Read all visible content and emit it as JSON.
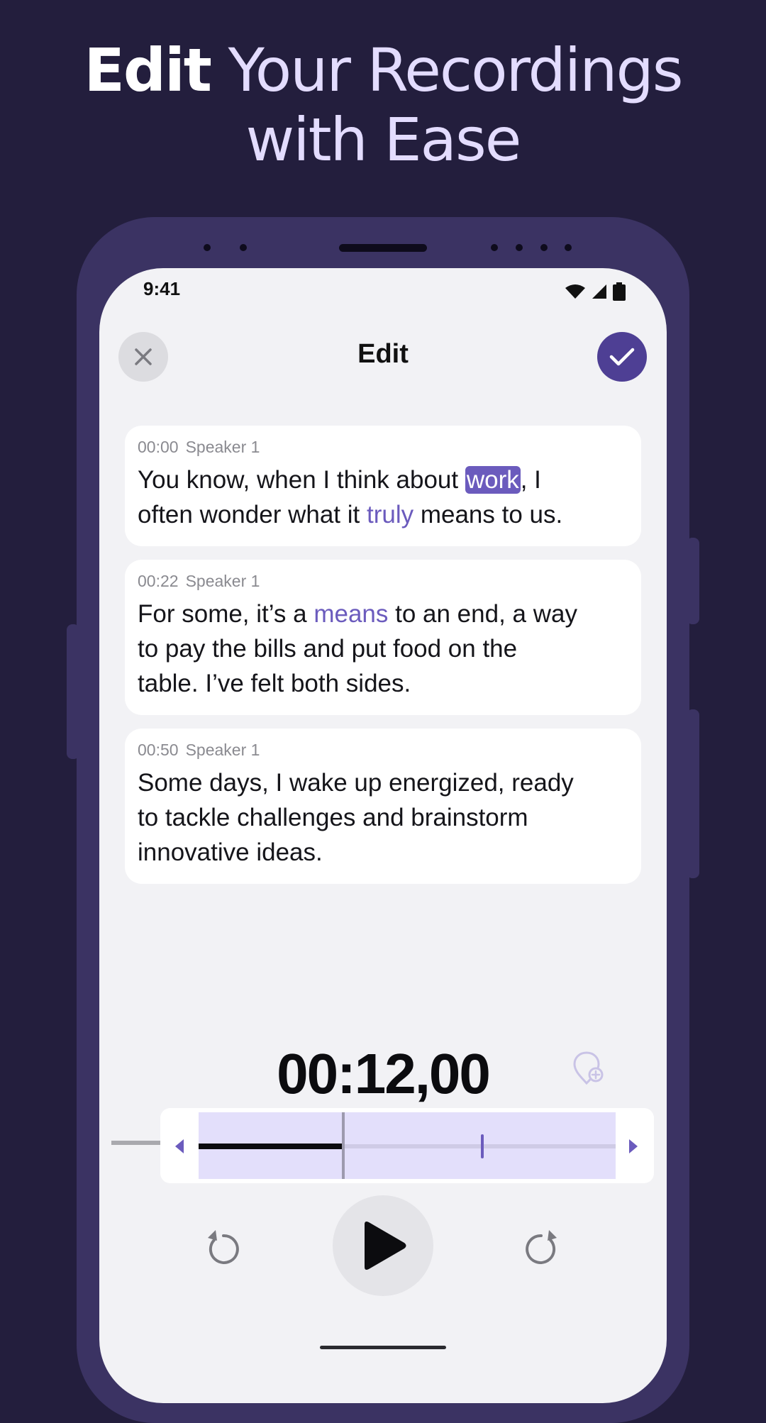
{
  "headline": {
    "bold": "Edit",
    "rest_line1": " Your Recordings",
    "line2": "with Ease"
  },
  "status_bar": {
    "time": "9:41"
  },
  "nav": {
    "title": "Edit",
    "close_icon": "close-icon",
    "confirm_icon": "checkmark-icon"
  },
  "transcript": [
    {
      "time": "00:00",
      "speaker": "Speaker 1",
      "text_a": "You know, when I think about ",
      "highlight": "work",
      "text_b": ", I\noften wonder what it ",
      "accent": "truly",
      "text_c": " means to us."
    },
    {
      "time": "00:22",
      "speaker": "Speaker 1",
      "text_a": "For some, it’s a ",
      "accent": "means",
      "text_b": " to an end, a way\nto pay the bills and put food on the\ntable. I’ve felt both sides."
    },
    {
      "time": "00:50",
      "speaker": "Speaker 1",
      "text_a": "Some days, I wake up energized, ready\nto tackle challenges and brainstorm\ninnovative ideas."
    }
  ],
  "player": {
    "timer": "00:12,00",
    "progress_fraction": 0.345,
    "marker_fraction": 0.68
  },
  "colors": {
    "background": "#231e3d",
    "accent": "#6b5bbd",
    "confirm": "#4e3f94",
    "headline": "#e3dcff"
  }
}
